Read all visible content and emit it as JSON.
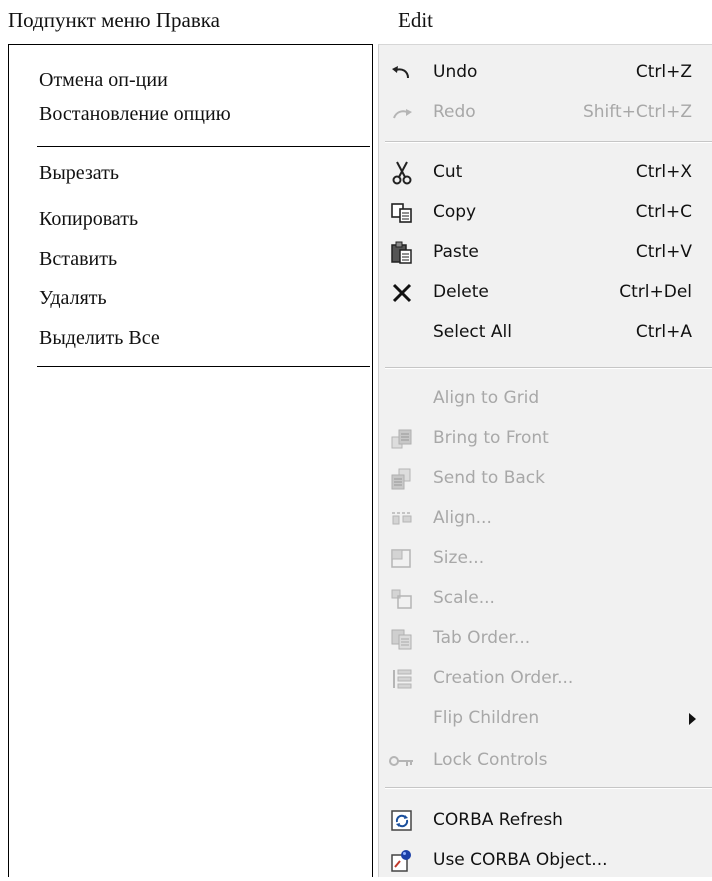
{
  "left_heading": "Подпункт меню Правка",
  "right_heading": "Edit",
  "translations": [
    "Отмена оп-ции",
    "Востановление опцию",
    "Вырезать",
    "Копировать",
    "Вставить",
    "Удалять",
    "Выделить Все"
  ],
  "menu": {
    "items": [
      {
        "label": "Undo",
        "shortcut": "Ctrl+Z",
        "icon": "undo-icon",
        "enabled": true
      },
      {
        "label": "Redo",
        "shortcut": "Shift+Ctrl+Z",
        "icon": "redo-icon",
        "enabled": false
      },
      {
        "label": "Cut",
        "shortcut": "Ctrl+X",
        "icon": "scissors-icon",
        "enabled": true
      },
      {
        "label": "Copy",
        "shortcut": "Ctrl+C",
        "icon": "copy-icon",
        "enabled": true
      },
      {
        "label": "Paste",
        "shortcut": "Ctrl+V",
        "icon": "paste-icon",
        "enabled": true
      },
      {
        "label": "Delete",
        "shortcut": "Ctrl+Del",
        "icon": "delete-x-icon",
        "enabled": true
      },
      {
        "label": "Select All",
        "shortcut": "Ctrl+A",
        "icon": "",
        "enabled": true
      },
      {
        "label": "Align to Grid",
        "shortcut": "",
        "icon": "",
        "enabled": false
      },
      {
        "label": "Bring to Front",
        "shortcut": "",
        "icon": "bring-to-front-icon",
        "enabled": false
      },
      {
        "label": "Send to Back",
        "shortcut": "",
        "icon": "send-to-back-icon",
        "enabled": false
      },
      {
        "label": "Align...",
        "shortcut": "",
        "icon": "align-icon",
        "enabled": false
      },
      {
        "label": "Size...",
        "shortcut": "",
        "icon": "size-icon",
        "enabled": false
      },
      {
        "label": "Scale...",
        "shortcut": "",
        "icon": "scale-icon",
        "enabled": false
      },
      {
        "label": "Tab Order...",
        "shortcut": "",
        "icon": "tab-order-icon",
        "enabled": false
      },
      {
        "label": "Creation Order...",
        "shortcut": "",
        "icon": "creation-order-icon",
        "enabled": false
      },
      {
        "label": "Flip Children",
        "shortcut": "",
        "icon": "",
        "enabled": false,
        "submenu": true
      },
      {
        "label": "Lock Controls",
        "shortcut": "",
        "icon": "lock-controls-icon",
        "enabled": false
      },
      {
        "label": "CORBA Refresh",
        "shortcut": "",
        "icon": "corba-refresh-icon",
        "enabled": true
      },
      {
        "label": "Use CORBA Object...",
        "shortcut": "",
        "icon": "corba-object-icon",
        "enabled": true
      }
    ]
  },
  "colors": {
    "menu_background": "#f1f1f1",
    "disabled_text": "#a8a8a8"
  }
}
